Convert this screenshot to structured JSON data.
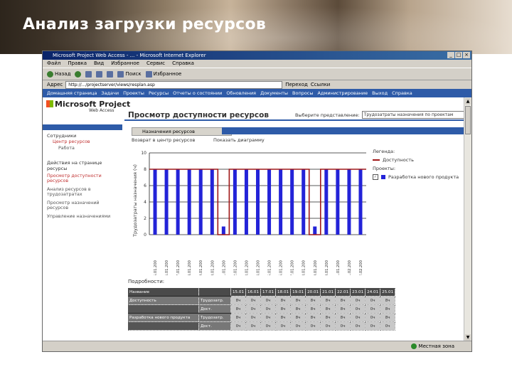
{
  "slide": {
    "title": "Анализ загрузки ресурсов"
  },
  "browser": {
    "title": "Microsoft Project Web Access - ... - Microsoft Internet Explorer",
    "menu": [
      "Файл",
      "Правка",
      "Вид",
      "Избранное",
      "Сервис",
      "Справка"
    ],
    "toolbar": {
      "back": "Назад",
      "search": "Поиск",
      "favorites": "Избранное"
    },
    "address_label": "Адрес",
    "address": "http://.../projectserver/views/resplan.asp",
    "go": "Переход",
    "links": "Ссылки",
    "status_zone": "Местная зона"
  },
  "nav": [
    "Домашняя страница",
    "Задачи",
    "Проекты",
    "Ресурсы",
    "Отчеты о состоянии",
    "Обновления",
    "Документы",
    "Вопросы",
    "Администрирование",
    "Выход",
    "Справка"
  ],
  "app": {
    "logo": "Microsoft Project",
    "logo_sub": "Web Access",
    "page_title": "Просмотр доступности ресурсов",
    "view_label": "Выберите представление:",
    "view_value": "Трудозатраты назначения по проектам"
  },
  "sidebar": {
    "section1": "Сотрудники",
    "links1": [
      "Центр ресурсов",
      "Работа"
    ],
    "section2": "Действия на странице ресурсы",
    "links2": [
      "Просмотр доступности ресурсов",
      "Анализ ресурсов в трудозатратах",
      "Просмотр назначений ресурсов",
      "Управление назначениями"
    ]
  },
  "tab_label": "Назначения ресурсов",
  "chart_toolbar": {
    "back": "Возврат в центр ресурсов",
    "mid": "Показать диаграмму"
  },
  "legend": {
    "title": "Легенда:",
    "availability": "Доступность",
    "group_title": "Проекты:",
    "project_item": "Разработка нового продукта"
  },
  "details_title": "Подробности:",
  "grid": {
    "header": [
      "Название",
      "",
      "15.01",
      "16.01",
      "17.01",
      "18.01",
      "19.01",
      "20.01",
      "21.01",
      "22.01",
      "23.01",
      "24.01",
      "25.01"
    ],
    "rows": [
      {
        "name": "Доступность",
        "type": "Трудозатр.",
        "values": [
          "8ч",
          "0ч",
          "0ч",
          "8ч",
          "8ч",
          "8ч",
          "8ч",
          "8ч",
          "0ч",
          "0ч",
          "8ч"
        ]
      },
      {
        "name": "",
        "type": "Дост.",
        "values": [
          "8ч",
          "0ч",
          "0ч",
          "8ч",
          "8ч",
          "8ч",
          "8ч",
          "8ч",
          "0ч",
          "0ч",
          "8ч"
        ]
      },
      {
        "name": "Разработка нового продукта",
        "type": "Трудозатр.",
        "values": [
          "8ч",
          "0ч",
          "0ч",
          "8ч",
          "8ч",
          "8ч",
          "8ч",
          "8ч",
          "0ч",
          "0ч",
          "8ч"
        ]
      },
      {
        "name": "",
        "type": "Дост.",
        "values": [
          "0ч",
          "0ч",
          "0ч",
          "0ч",
          "0ч",
          "0ч",
          "0ч",
          "0ч",
          "0ч",
          "0ч",
          "0ч"
        ]
      }
    ]
  },
  "chart_data": {
    "type": "bar",
    "ylabel": "Трудозатраты назначения (ч)",
    "ylim": [
      0,
      10
    ],
    "yticks": [
      0,
      2,
      4,
      6,
      8,
      10
    ],
    "categories": [
      "15.01.200",
      "16.01.200",
      "17.01.200",
      "18.01.200",
      "19.01.200",
      "20.01.200",
      "21.01.200",
      "22.01.200",
      "23.01.200",
      "24.01.200",
      "25.01.200",
      "26.01.200",
      "27.01.200",
      "28.01.200",
      "29.01.200",
      "30.01.200",
      "31.01.200",
      "01.02.200",
      "02.02.200"
    ],
    "series": [
      {
        "name": "Разработка нового продукта",
        "type": "bar",
        "color": "#2323d8",
        "values": [
          8,
          8,
          8,
          8,
          8,
          8,
          1,
          8,
          8,
          8,
          8,
          8,
          8,
          8,
          1,
          8,
          8,
          8,
          8
        ]
      },
      {
        "name": "Доступность",
        "type": "step",
        "color": "#a01818",
        "values": [
          8,
          8,
          8,
          8,
          8,
          8,
          0,
          8,
          8,
          8,
          8,
          8,
          8,
          8,
          0,
          8,
          8,
          8,
          8
        ]
      }
    ],
    "grid": true
  }
}
